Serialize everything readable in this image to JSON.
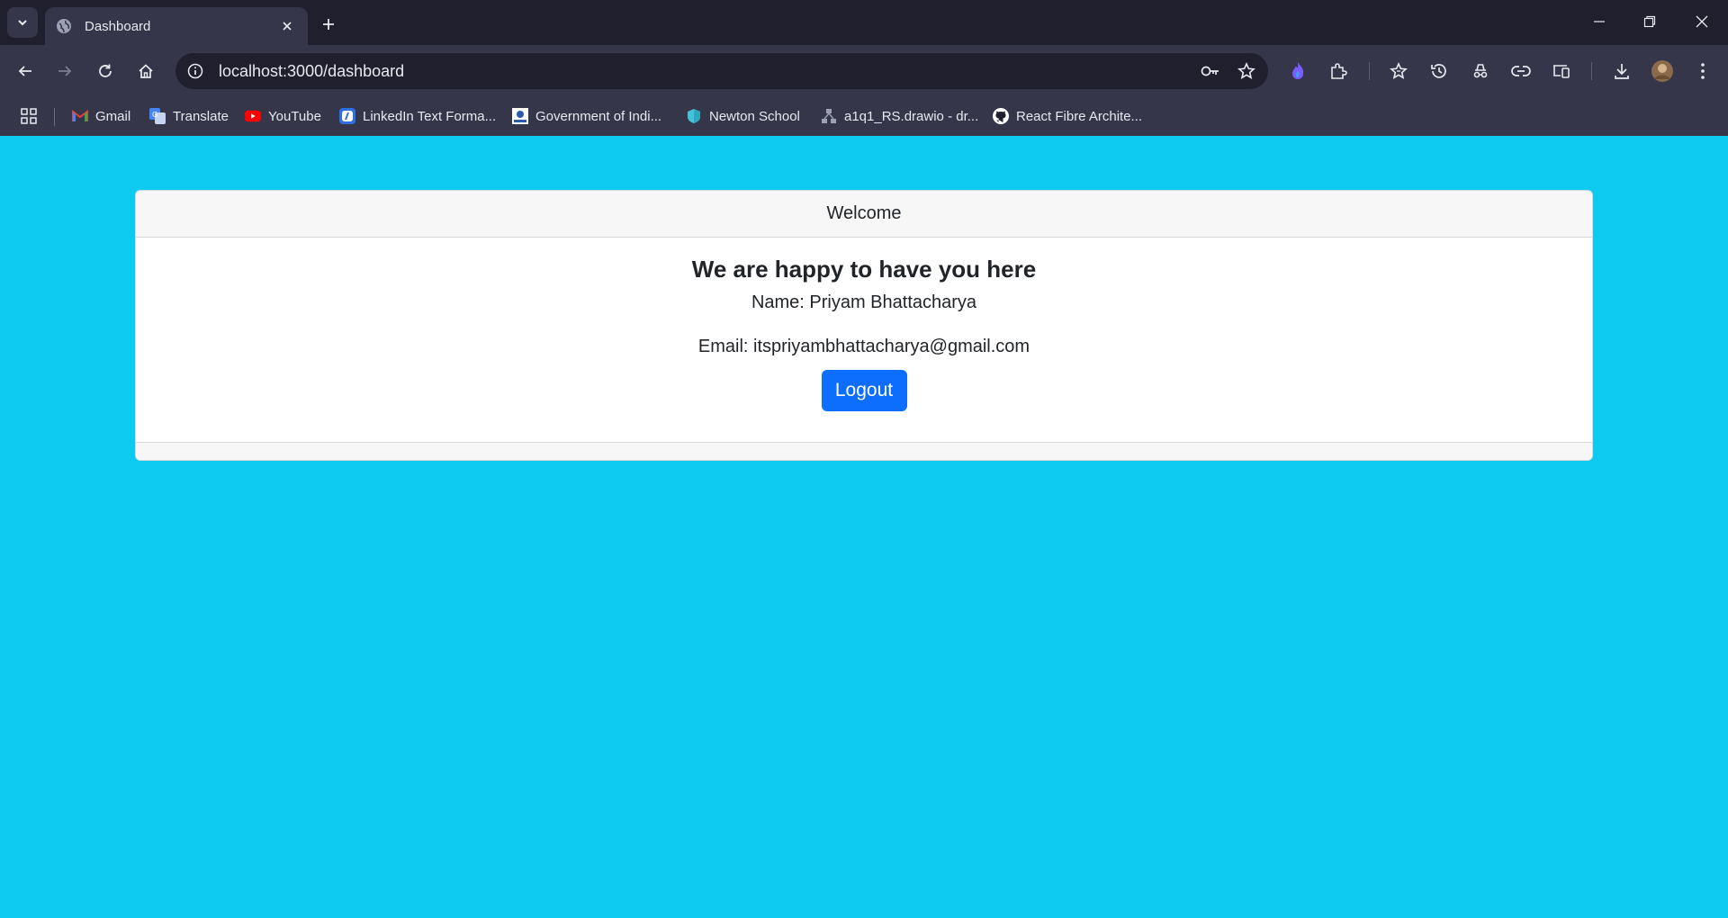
{
  "browser": {
    "tab": {
      "title": "Dashboard"
    },
    "url": "localhost:3000/dashboard",
    "bookmarks": [
      {
        "label": "Gmail",
        "icon": "gmail-icon"
      },
      {
        "label": "Translate",
        "icon": "translate-icon"
      },
      {
        "label": "YouTube",
        "icon": "youtube-icon"
      },
      {
        "label": "LinkedIn Text Forma...",
        "icon": "linkedin-formatter-icon"
      },
      {
        "label": "Government of Indi...",
        "icon": "government-icon"
      },
      {
        "label": "Newton School",
        "icon": "newton-school-icon"
      },
      {
        "label": "a1q1_RS.drawio - dr...",
        "icon": "drawio-icon"
      },
      {
        "label": "React  Fibre Archite...",
        "icon": "github-icon"
      }
    ]
  },
  "dashboard": {
    "header": "Welcome",
    "title": "We are happy to have you here",
    "name_line": "Name: Priyam Bhattacharya",
    "email_line": "Email: itspriyambhattacharya@gmail.com",
    "logout_label": "Logout"
  },
  "colors": {
    "page_background": "#0dcaf0",
    "primary_button": "#0d6efd",
    "browser_frame": "#1f1f2e",
    "browser_toolbar": "#35364a"
  }
}
